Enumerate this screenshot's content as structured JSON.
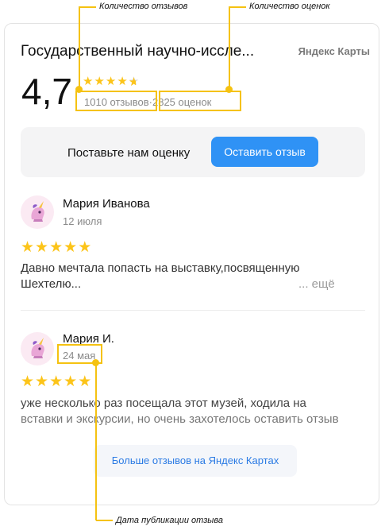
{
  "annotations": {
    "reviews_count": "Количество отзывов",
    "ratings_count": "Количество оценок",
    "publish_date": "Дата публикации отзыва"
  },
  "widget": {
    "title": "Государственный научно-иссле...",
    "brand": "Яндекс Карты",
    "rating": "4,7",
    "rating_value": 4.7,
    "reviews_count": "1010 отзывов",
    "ratings_count": "2825 оценок",
    "cta_text": "Поставьте нам оценку",
    "cta_button": "Оставить отзыв",
    "more_button": "Больше отзывов на Яндекс Картах"
  },
  "reviews": [
    {
      "author": "Мария Иванова",
      "date": "12 июля",
      "stars": 5,
      "text_line1": "Давно мечтала попасть на выставку,посвященную",
      "text_line2": "Шехтелю...",
      "more": "... ещё",
      "avatar_icon": "unicorn-icon"
    },
    {
      "author": "Мария И.",
      "date": "24 мая",
      "stars": 5,
      "text_line1": "уже несколько раз посещала этот музей, ходила на",
      "text_line2": "вставки и экскурсии, но очень захотелось оставить отзыв",
      "avatar_icon": "unicorn-icon"
    }
  ],
  "colors": {
    "annotation": "#f5c211",
    "star": "#fcc419",
    "button": "#2f92f5",
    "link": "#2b7be4"
  }
}
